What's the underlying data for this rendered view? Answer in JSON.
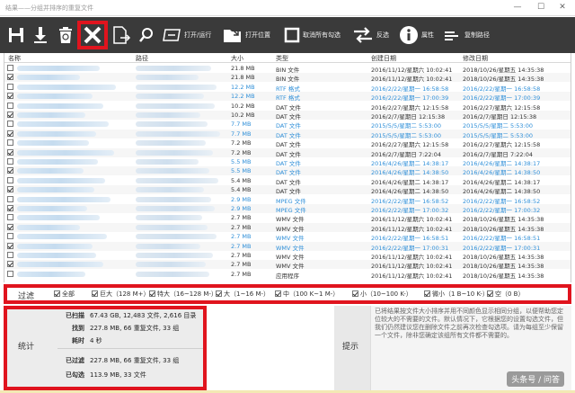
{
  "window": {
    "title": "结果——分组并排序的重复文件",
    "minimize": "—",
    "maximize": "☐",
    "close": "✕"
  },
  "toolbar": {
    "open_run": "打开/运行",
    "open_location": "打开位置",
    "uncheck_all": "取消所有勾选",
    "invert": "反选",
    "properties": "属性",
    "copy_path": "复制路径",
    "icons": [
      "save-icon",
      "download-icon",
      "recycle-bin-icon",
      "delete-x-icon",
      "move-file-icon",
      "search-icon",
      "rename-icon"
    ]
  },
  "columns": {
    "name": "名称",
    "path": "路径",
    "size": "大小",
    "type": "类型",
    "created": "创建日期",
    "modified": "修改日期"
  },
  "rows": [
    {
      "checked": false,
      "size": "21.8 MB",
      "type": "BIN 文件",
      "created": "2016/11/12/星期六 10:02:41",
      "modified": "2018/10/26/星期五 14:35:38",
      "color": "dark"
    },
    {
      "checked": true,
      "size": "21.8 MB",
      "type": "BIN 文件",
      "created": "2016/11/12/星期六 10:02:41",
      "modified": "2018/10/26/星期五 14:35:38",
      "color": "dark"
    },
    {
      "checked": false,
      "size": "12.2 MB",
      "type": "RTF 格式",
      "created": "2016/2/22/星期一 16:58:58",
      "modified": "2016/2/22/星期一 16:58:58",
      "color": "blue"
    },
    {
      "checked": true,
      "size": "12.2 MB",
      "type": "RTF 格式",
      "created": "2016/2/22/星期一 17:00:39",
      "modified": "2016/2/22/星期一 17:00:39",
      "color": "blue"
    },
    {
      "checked": false,
      "size": "10.2 MB",
      "type": "DAT 文件",
      "created": "2016/2/27/星期六 12:15:58",
      "modified": "2016/2/27/星期六 12:15:58",
      "color": "dark"
    },
    {
      "checked": true,
      "size": "10.2 MB",
      "type": "DAT 文件",
      "created": "2016/2/7/星期日 12:15:38",
      "modified": "2016/2/7/星期日 12:15:38",
      "color": "dark"
    },
    {
      "checked": false,
      "size": "7.7 MB",
      "type": "DAT 文件",
      "created": "2015/5/5/星期二 5:53:00",
      "modified": "2015/5/5/星期二 5:53:00",
      "color": "blue"
    },
    {
      "checked": true,
      "size": "7.7 MB",
      "type": "DAT 文件",
      "created": "2015/5/5/星期二 5:53:00",
      "modified": "2015/5/5/星期二 5:53:00",
      "color": "blue"
    },
    {
      "checked": false,
      "size": "7.2 MB",
      "type": "DAT 文件",
      "created": "2016/2/27/星期六 12:15:58",
      "modified": "2016/2/27/星期六 12:15:58",
      "color": "dark"
    },
    {
      "checked": true,
      "size": "7.2 MB",
      "type": "DAT 文件",
      "created": "2016/2/7/星期日 7:22:04",
      "modified": "2016/2/7/星期日 7:22:04",
      "color": "dark"
    },
    {
      "checked": false,
      "size": "5.5 MB",
      "type": "DAT 文件",
      "created": "2016/4/26/星期二 14:38:17",
      "modified": "2016/4/26/星期二 14:38:17",
      "color": "blue"
    },
    {
      "checked": true,
      "size": "5.5 MB",
      "type": "DAT 文件",
      "created": "2016/4/26/星期二 14:38:50",
      "modified": "2016/4/26/星期二 14:38:50",
      "color": "blue"
    },
    {
      "checked": false,
      "size": "5.4 MB",
      "type": "DAT 文件",
      "created": "2016/4/26/星期二 14:38:17",
      "modified": "2016/4/26/星期二 14:38:17",
      "color": "dark"
    },
    {
      "checked": true,
      "size": "5.4 MB",
      "type": "DAT 文件",
      "created": "2016/4/26/星期二 14:38:50",
      "modified": "2016/4/26/星期二 14:38:50",
      "color": "dark"
    },
    {
      "checked": false,
      "size": "2.9 MB",
      "type": "MPEG 文件",
      "created": "2016/2/22/星期一 16:58:52",
      "modified": "2016/2/22/星期一 16:58:52",
      "color": "blue"
    },
    {
      "checked": true,
      "size": "2.9 MB",
      "type": "MPEG 文件",
      "created": "2016/2/22/星期一 17:00:32",
      "modified": "2016/2/22/星期一 17:00:32",
      "color": "blue"
    },
    {
      "checked": false,
      "size": "2.7 MB",
      "type": "WMV 文件",
      "created": "2016/11/12/星期六 10:02:41",
      "modified": "2018/10/26/星期五 14:35:38",
      "color": "dark"
    },
    {
      "checked": true,
      "size": "2.7 MB",
      "type": "WMV 文件",
      "created": "2016/11/12/星期六 10:02:41",
      "modified": "2018/10/26/星期五 14:35:38",
      "color": "dark"
    },
    {
      "checked": false,
      "size": "2.7 MB",
      "type": "WMV 文件",
      "created": "2016/2/22/星期一 16:58:51",
      "modified": "2016/2/22/星期一 16:58:51",
      "color": "blue"
    },
    {
      "checked": true,
      "size": "2.7 MB",
      "type": "WMV 文件",
      "created": "2016/2/22/星期一 17:00:31",
      "modified": "2016/2/22/星期一 17:00:31",
      "color": "blue"
    },
    {
      "checked": false,
      "size": "2.7 MB",
      "type": "WMV 文件",
      "created": "2016/11/12/星期六 10:02:41",
      "modified": "2018/10/26/星期五 14:35:38",
      "color": "dark"
    },
    {
      "checked": true,
      "size": "2.7 MB",
      "type": "WMV 文件",
      "created": "2016/11/12/星期六 10:02:41",
      "modified": "2018/10/26/星期五 14:35:38",
      "color": "dark"
    },
    {
      "checked": false,
      "size": "2.7 MB",
      "type": "应用程序",
      "created": "2016/11/12/星期六 10:02:41",
      "modified": "2018/10/26/星期五 14:35:38",
      "color": "dark"
    }
  ],
  "filter": {
    "label": "过滤",
    "items": [
      "全部",
      "巨大（128 M+）",
      "特大（16~128 M-）",
      "大（1~16 M-）",
      "中（100 K~1 M-）",
      "小（10~100 K-）",
      "微小（1 B~10 K-）",
      "空（0 B）"
    ]
  },
  "stats": {
    "label": "统计",
    "scanned_label": "已扫描",
    "scanned_value": "67.43 GB, 12,483 文件, 2,616 目录",
    "found_label": "找到",
    "found_value": "227.8 MB, 66 重复文件, 33 组",
    "time_label": "耗时",
    "time_value": "4 秒",
    "filtered_label": "已过滤",
    "filtered_value": "227.8 MB, 66 重复文件, 33 组",
    "checked_label": "已勾选",
    "checked_value": "113.9 MB, 33 文件"
  },
  "tips": {
    "label": "提示",
    "text": "已将结果按文件大小排序并用不同颜色显示相同分组，以便帮助您定位较大的不需要的文件。默认情况下，它根据您的设置勾选文件，但我们仍然建议您在删除文件之前再次检查勾选项。请为每组至少保留一个文件，除非您确定该组所有文件都不需要的。"
  },
  "watermark": "头条号 / 问答",
  "colors": {
    "accent_red": "#e0141e",
    "toolbar_bg": "#3a3a3a",
    "group_blue": "#2f8fd8"
  }
}
